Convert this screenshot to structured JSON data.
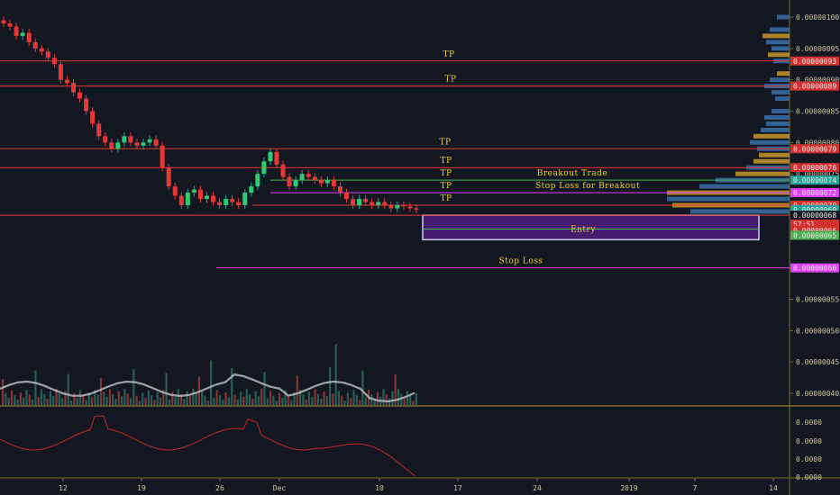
{
  "chart_data": {
    "type": "candlestick",
    "price_axis": {
      "min": 3.6e-07,
      "max": 1.01e-06,
      "ticks": [
        "0.00000100",
        "0.00000095",
        "0.00000090",
        "0.00000085",
        "0.00000080",
        "0.00000075",
        "0.00000070",
        "0.00000065",
        "0.00000060",
        "0.00000055",
        "0.00000050",
        "0.00000045",
        "0.00000040"
      ]
    },
    "price_labels": [
      {
        "text": "0.00000093",
        "value": 9.3e-07,
        "bg": "#d32f2f"
      },
      {
        "text": "0.00000089",
        "value": 8.9e-07,
        "bg": "#d32f2f"
      },
      {
        "text": "0.00000079",
        "value": 7.9e-07,
        "bg": "#d32f2f"
      },
      {
        "text": "0.00000076",
        "value": 7.6e-07,
        "bg": "#d32f2f"
      },
      {
        "text": "0.00000074",
        "value": 7.4e-07,
        "bg": "#26a69a"
      },
      {
        "text": "0.00000072",
        "value": 7.2e-07,
        "bg": "#e040fb"
      },
      {
        "text": "0.00000070",
        "value": 7e-07,
        "bg": "#d32f2f"
      },
      {
        "text": "0.00000069",
        "value": 6.93e-07,
        "bg": "#26a69a"
      },
      {
        "text": "0.00000068",
        "value": 6.84e-07,
        "bg": "#131722",
        "fg": "#e9e9e9"
      },
      {
        "text": "57:51",
        "value": 6.7e-07,
        "bg": "#d32f2f"
      },
      {
        "text": "0.00000066",
        "value": 6.6e-07,
        "bg": "#d32f2f"
      },
      {
        "text": "0.00000065",
        "value": 6.52e-07,
        "bg": "#4caf50"
      },
      {
        "text": "0.00000060",
        "value": 6e-07,
        "bg": "#e040fb"
      }
    ],
    "horizontal_levels": [
      {
        "label": "TP",
        "value": 9.3e-07,
        "color": "#e53935"
      },
      {
        "label": "TP",
        "value": 8.9e-07,
        "color": "#e53935"
      },
      {
        "label": "TP",
        "value": 7.9e-07,
        "color": "#e53935"
      },
      {
        "label": "TP",
        "value": 7.6e-07,
        "color": "#e53935"
      },
      {
        "label": "TP",
        "value": 7.4e-07,
        "color": "#e53935"
      },
      {
        "label": "TP",
        "value": 7.2e-07,
        "color": "#e040fb"
      },
      {
        "label": "TP",
        "value": 7e-07,
        "color": "#e53935"
      },
      {
        "label": "Breakout Trade",
        "value": 7.4e-07,
        "color": "#4caf50"
      },
      {
        "label": "Stop Loss for Breakout",
        "value": 7.2e-07,
        "color": "#e040fb"
      },
      {
        "label": "Stop Loss",
        "value": 6e-07,
        "color": "#e040fb"
      }
    ],
    "entry_zone": {
      "label": "Entry",
      "top": 6.84e-07,
      "bottom": 6.45e-07,
      "mid": 6.62e-07
    },
    "date_labels": [
      "12",
      "19",
      "26",
      "Dec",
      "10",
      "17",
      "24",
      "2019",
      "7",
      "14"
    ],
    "oscillator_ticks": [
      "0.0000",
      "0.0000",
      "0.0000",
      "0.0000",
      "0.0000"
    ],
    "closes": [
      9.9e-07,
      9.85e-07,
      9.7e-07,
      9.75e-07,
      9.6e-07,
      9.5e-07,
      9.45e-07,
      9.35e-07,
      9.25e-07,
      9e-07,
      8.95e-07,
      8.8e-07,
      8.7e-07,
      8.5e-07,
      8.3e-07,
      8.1e-07,
      8e-07,
      7.9e-07,
      8e-07,
      8.1e-07,
      8e-07,
      7.95e-07,
      8e-07,
      8.05e-07,
      7.95e-07,
      7.6e-07,
      7.3e-07,
      7.15e-07,
      7e-07,
      7.2e-07,
      7.25e-07,
      7.1e-07,
      7.15e-07,
      7.05e-07,
      7e-07,
      7.1e-07,
      7.05e-07,
      7e-07,
      7.2e-07,
      7.3e-07,
      7.5e-07,
      7.7e-07,
      7.85e-07,
      7.65e-07,
      7.45e-07,
      7.3e-07,
      7.4e-07,
      7.5e-07,
      7.45e-07,
      7.4e-07,
      7.35e-07,
      7.4e-07,
      7.3e-07,
      7.2e-07,
      7.1e-07,
      7e-07,
      7.1e-07,
      7.05e-07,
      7e-07,
      7.05e-07,
      7e-07,
      6.95e-07,
      7e-07,
      6.98e-07,
      6.95e-07,
      6.93e-07
    ]
  },
  "text": {
    "tp": "TP",
    "breakout": "Breakout Trade",
    "sl_breakout": "Stop Loss for Breakout",
    "entry": "Entry",
    "stop_loss": "Stop Loss"
  }
}
